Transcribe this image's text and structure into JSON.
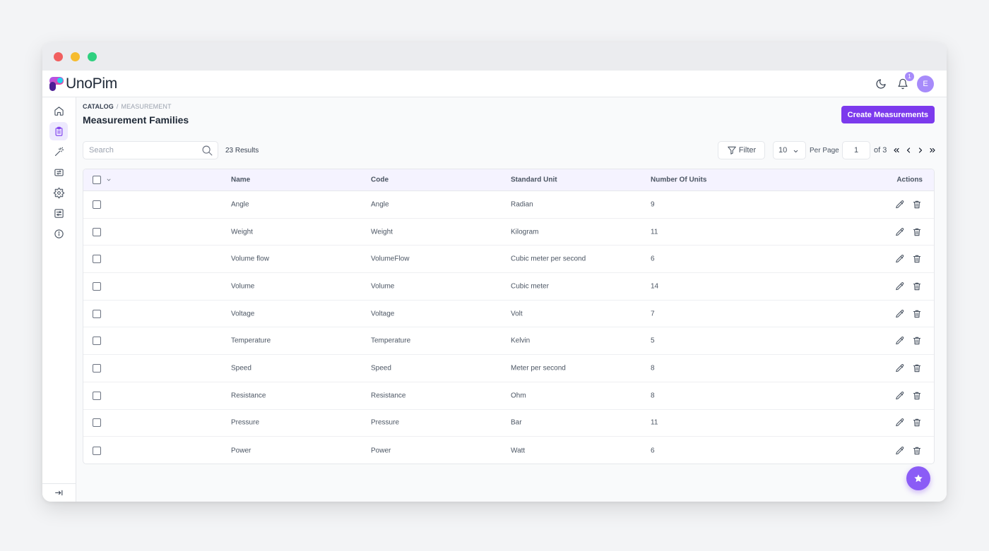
{
  "app": {
    "name": "UnoPim",
    "brand_color": "#7c3aed"
  },
  "header": {
    "notification_count": "1",
    "avatar_initial": "E"
  },
  "sidebar": {
    "items": [
      {
        "name": "dashboard",
        "icon": "home-icon",
        "active": false
      },
      {
        "name": "catalog",
        "icon": "clipboard-list-icon",
        "active": true
      },
      {
        "name": "data-transfer",
        "icon": "magic-wand-icon",
        "active": false
      },
      {
        "name": "import-export",
        "icon": "arrows-exchange-icon",
        "active": false
      },
      {
        "name": "settings",
        "icon": "gear-icon",
        "active": false
      },
      {
        "name": "configuration",
        "icon": "sliders-icon",
        "active": false
      },
      {
        "name": "help",
        "icon": "info-circle-icon",
        "active": false
      }
    ],
    "collapse_icon": "collapse-arrow-icon"
  },
  "breadcrumb": {
    "catalog": "Catalog",
    "separator": "/",
    "current": "Measurement"
  },
  "page": {
    "title": "Measurement Families",
    "create_button": "Create Measurements"
  },
  "toolbar": {
    "search_placeholder": "Search",
    "results": "23 Results",
    "filter_label": "Filter",
    "per_page_value": "10",
    "per_page_label": "Per Page",
    "page_value": "1",
    "of_pages": "of 3"
  },
  "table": {
    "columns": {
      "name": "Name",
      "code": "Code",
      "standard_unit": "Standard Unit",
      "number_of_units": "Number Of Units",
      "actions": "Actions"
    },
    "rows": [
      {
        "name": "Angle",
        "code": "Angle",
        "standard_unit": "Radian",
        "number_of_units": "9"
      },
      {
        "name": "Weight",
        "code": "Weight",
        "standard_unit": "Kilogram",
        "number_of_units": "11"
      },
      {
        "name": "Volume flow",
        "code": "VolumeFlow",
        "standard_unit": "Cubic meter per second",
        "number_of_units": "6"
      },
      {
        "name": "Volume",
        "code": "Volume",
        "standard_unit": "Cubic meter",
        "number_of_units": "14"
      },
      {
        "name": "Voltage",
        "code": "Voltage",
        "standard_unit": "Volt",
        "number_of_units": "7"
      },
      {
        "name": "Temperature",
        "code": "Temperature",
        "standard_unit": "Kelvin",
        "number_of_units": "5"
      },
      {
        "name": "Speed",
        "code": "Speed",
        "standard_unit": "Meter per second",
        "number_of_units": "8"
      },
      {
        "name": "Resistance",
        "code": "Resistance",
        "standard_unit": "Ohm",
        "number_of_units": "8"
      },
      {
        "name": "Pressure",
        "code": "Pressure",
        "standard_unit": "Bar",
        "number_of_units": "11"
      },
      {
        "name": "Power",
        "code": "Power",
        "standard_unit": "Watt",
        "number_of_units": "6"
      }
    ]
  }
}
